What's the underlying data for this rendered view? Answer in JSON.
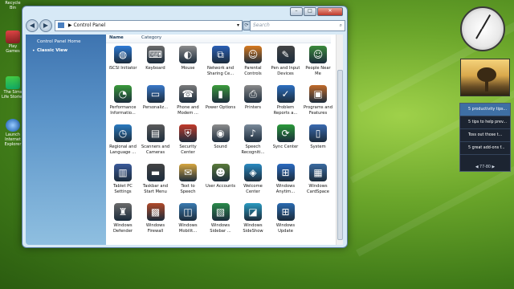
{
  "desktop": {
    "icons": [
      {
        "label": "Recycle Bin"
      },
      {
        "label": "Play Games"
      },
      {
        "label": "The Sims Life Stories"
      },
      {
        "label": "Launch Internet Explorer"
      }
    ]
  },
  "window": {
    "caption": {
      "minimize": "–",
      "maximize": "□",
      "close": "✕"
    },
    "nav": {
      "back": "◀",
      "forward": "▶",
      "address": "Control Panel",
      "search_placeholder": "Search"
    },
    "sidebar": {
      "links": [
        {
          "label": "Control Panel Home"
        },
        {
          "label": "Classic View"
        }
      ]
    },
    "columns": [
      "Name",
      "Category"
    ],
    "items": [
      {
        "label": "iSCSI Initiator",
        "icon": "globe-icon",
        "color": "#2e7bd6"
      },
      {
        "label": "Keyboard",
        "icon": "keyboard-icon",
        "color": "#6b6b6b"
      },
      {
        "label": "Mouse",
        "icon": "mouse-icon",
        "color": "#8c8c8c"
      },
      {
        "label": "Network and Sharing Ce...",
        "icon": "network-icon",
        "color": "#2a5fb5"
      },
      {
        "label": "Parental Controls",
        "icon": "people-icon",
        "color": "#d87a1f"
      },
      {
        "label": "Pen and Input Devices",
        "icon": "pen-icon",
        "color": "#444444"
      },
      {
        "label": "People Near Me",
        "icon": "people-icon",
        "color": "#3b8a3b"
      },
      {
        "label": "Performance Informatio...",
        "icon": "gauge-icon",
        "color": "#3a9a3a"
      },
      {
        "label": "Personaliz...",
        "icon": "monitor-icon",
        "color": "#3a78c8"
      },
      {
        "label": "Phone and Modem ...",
        "icon": "phone-icon",
        "color": "#7a7a7a"
      },
      {
        "label": "Power Options",
        "icon": "battery-icon",
        "color": "#3c9c3c"
      },
      {
        "label": "Printers",
        "icon": "printer-icon",
        "color": "#8a8a8a"
      },
      {
        "label": "Problem Reports a...",
        "icon": "report-icon",
        "color": "#2d6fc0"
      },
      {
        "label": "Programs and Features",
        "icon": "box-icon",
        "color": "#c06a2a"
      },
      {
        "label": "Regional and Language ...",
        "icon": "globe-clock-icon",
        "color": "#2a7ac0"
      },
      {
        "label": "Scanners and Cameras",
        "icon": "scanner-icon",
        "color": "#5a5a5a"
      },
      {
        "label": "Security Center",
        "icon": "shield-icon",
        "color": "#c23a2a"
      },
      {
        "label": "Sound",
        "icon": "speaker-icon",
        "color": "#8c8c8c"
      },
      {
        "label": "Speech Recogniti...",
        "icon": "microphone-icon",
        "color": "#7a8a9a"
      },
      {
        "label": "Sync Center",
        "icon": "sync-icon",
        "color": "#2a9a3a"
      },
      {
        "label": "System",
        "icon": "computer-icon",
        "color": "#3a6ab0"
      },
      {
        "label": "Tablet PC Settings",
        "icon": "tablet-icon",
        "color": "#3a5a9a"
      },
      {
        "label": "Taskbar and Start Menu",
        "icon": "taskbar-icon",
        "color": "#444444"
      },
      {
        "label": "Text to Speech",
        "icon": "speech-icon",
        "color": "#d6a640"
      },
      {
        "label": "User Accounts",
        "icon": "users-icon",
        "color": "#5a7a3a"
      },
      {
        "label": "Welcome Center",
        "icon": "welcome-icon",
        "color": "#2a8ac0"
      },
      {
        "label": "Windows Anytim...",
        "icon": "windows-flag-icon",
        "color": "#2a6ac0"
      },
      {
        "label": "Windows CardSpace",
        "icon": "card-icon",
        "color": "#3a6aa0"
      },
      {
        "label": "Windows Defender",
        "icon": "castle-icon",
        "color": "#6a6a6a"
      },
      {
        "label": "Windows Firewall",
        "icon": "firewall-icon",
        "color": "#b04a2a"
      },
      {
        "label": "Windows Mobilit...",
        "icon": "laptop-icon",
        "color": "#3a7ab0"
      },
      {
        "label": "Windows Sidebar ...",
        "icon": "sidebar-icon",
        "color": "#2a8a4a"
      },
      {
        "label": "Windows SideShow",
        "icon": "sideshow-icon",
        "color": "#2a9ac0"
      },
      {
        "label": "Windows Update",
        "icon": "update-icon",
        "color": "#2a6ab0"
      }
    ]
  },
  "gadgets": {
    "feed": {
      "items": [
        {
          "label": "5 productivity tips..."
        },
        {
          "label": "5 tips to help prev..."
        },
        {
          "label": "Toss out those t..."
        },
        {
          "label": "5 great add-ons f..."
        }
      ],
      "nav": "◀  77-80  ▶"
    }
  }
}
